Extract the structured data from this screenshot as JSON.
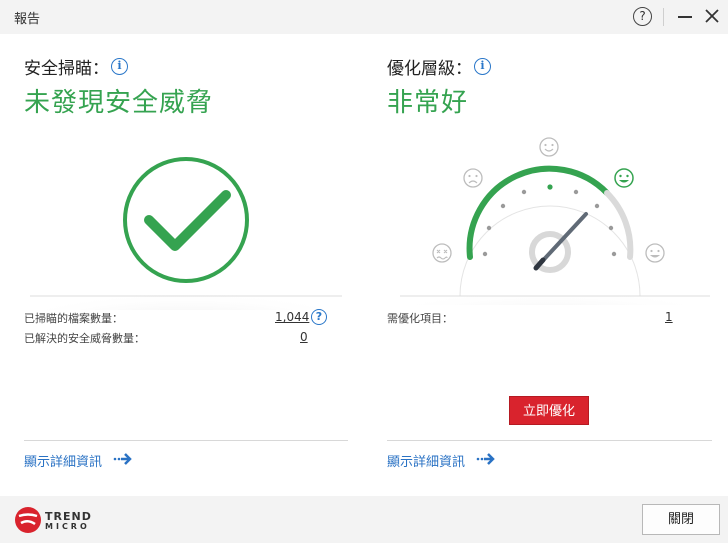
{
  "window": {
    "title": "報告",
    "help_label": "?"
  },
  "security": {
    "label": "安全掃瞄：",
    "info": "i",
    "status": "未發現安全威脅",
    "scanned_label": "已掃瞄的檔案數量：",
    "scanned_value": "1,044",
    "scanned_help": "?",
    "resolved_label": "已解決的安全威脅數量：",
    "resolved_value": "0",
    "details_link": "顯示詳細資訊"
  },
  "optimization": {
    "label": "優化層級：",
    "info": "i",
    "status": "非常好",
    "items_label": "需優化項目：",
    "items_value": "1",
    "optimize_button": "立即優化",
    "details_link": "顯示詳細資訊",
    "gauge_level": 0.88
  },
  "footer": {
    "close_button": "關閉",
    "logo_line1": "TREND",
    "logo_line2": "MICRO"
  },
  "colors": {
    "accent_green": "#35a350",
    "link_blue": "#2a72c4",
    "button_red": "#d9232d"
  }
}
